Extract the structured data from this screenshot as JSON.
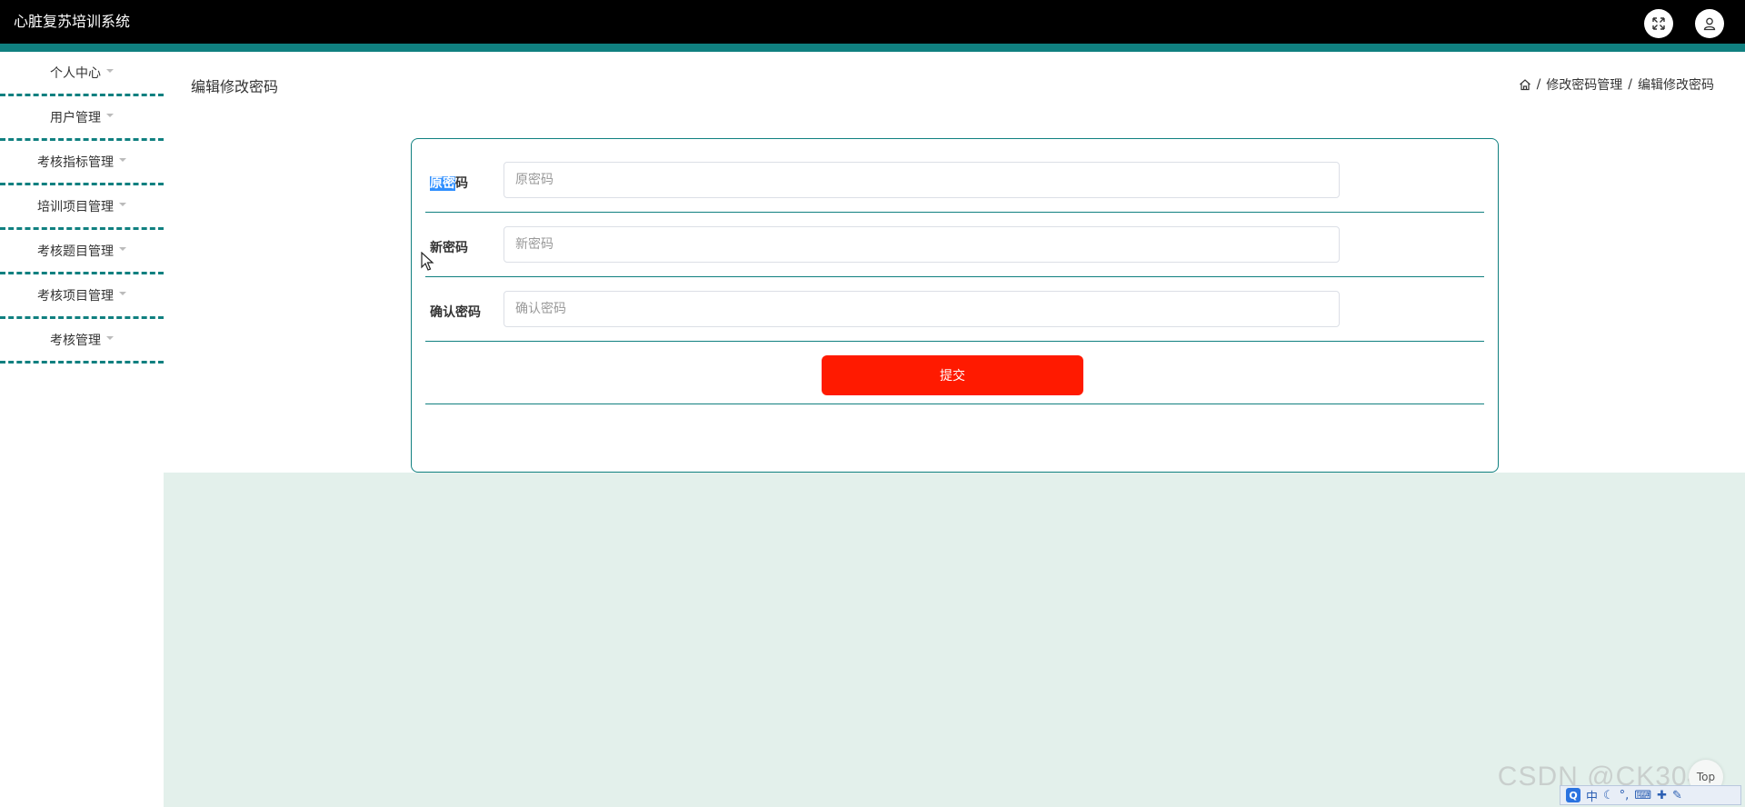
{
  "app": {
    "title": "心脏复苏培训系统"
  },
  "header": {
    "icons": [
      "fullscreen-icon",
      "user-icon"
    ]
  },
  "sidebar": {
    "items": [
      {
        "label": "个人中心"
      },
      {
        "label": "用户管理"
      },
      {
        "label": "考核指标管理"
      },
      {
        "label": "培训项目管理"
      },
      {
        "label": "考核题目管理"
      },
      {
        "label": "考核项目管理"
      },
      {
        "label": "考核管理"
      }
    ]
  },
  "page": {
    "title": "编辑修改密码",
    "breadcrumb": [
      "修改密码管理",
      "编辑修改密码"
    ]
  },
  "form": {
    "old_password": {
      "label_highlighted": "原密",
      "label_rest": "码",
      "placeholder": "原密码",
      "value": ""
    },
    "new_password": {
      "label": "新密码",
      "placeholder": "新密码",
      "value": ""
    },
    "confirm_password": {
      "label": "确认密码",
      "placeholder": "确认密码",
      "value": ""
    },
    "submit_label": "提交"
  },
  "overlay": {
    "watermark": "CSDN @CK3041",
    "top_button": "Top",
    "ime": {
      "logo": "Q",
      "mode": "中"
    }
  },
  "colors": {
    "topbar": "#000000",
    "accent": "#108080",
    "submit": "#ff1a00",
    "content_bg": "#e3f0eb",
    "highlight": "#2f8fff"
  }
}
